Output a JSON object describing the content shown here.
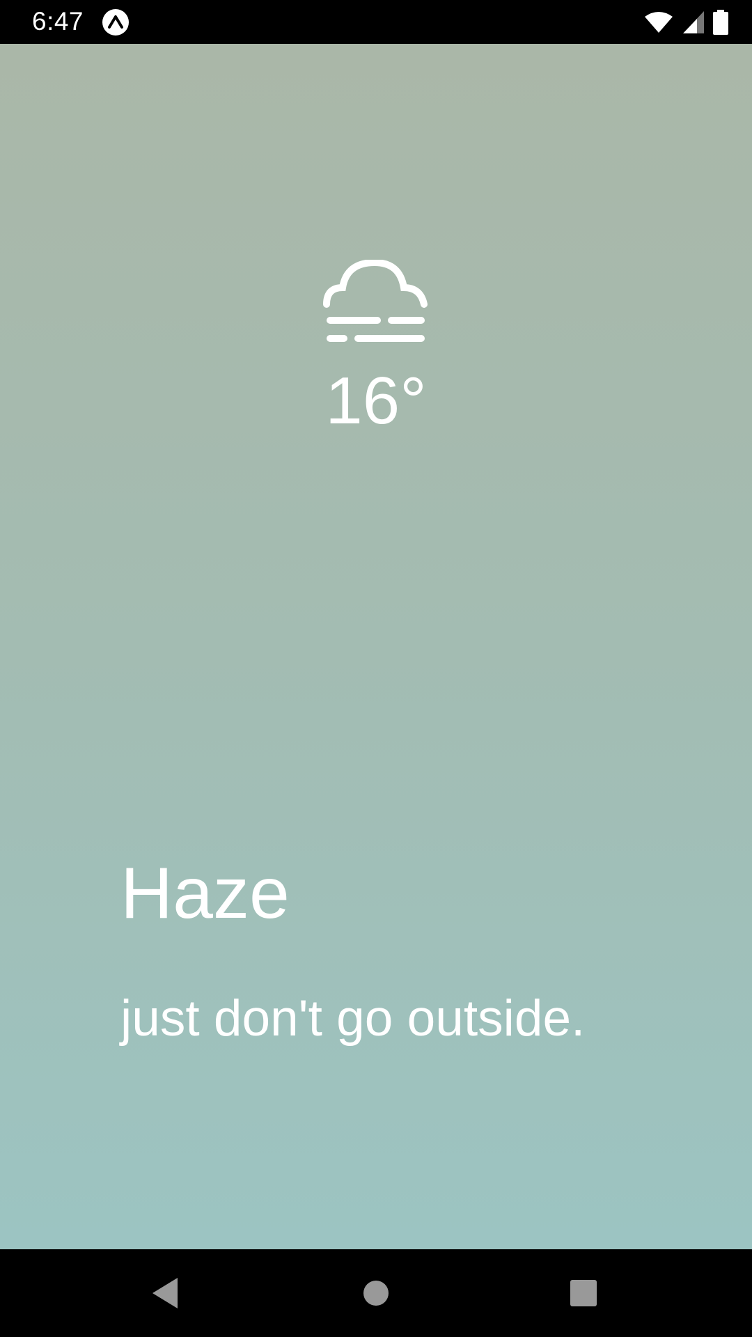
{
  "status_bar": {
    "time": "6:47",
    "app_icon": "expo-icon",
    "icons": [
      "wifi-icon",
      "cellular-signal-icon",
      "battery-icon"
    ]
  },
  "weather": {
    "icon": "haze-cloud-icon",
    "temperature": "16°",
    "condition": "Haze",
    "tagline": "just don't go outside."
  },
  "nav_bar": {
    "buttons": [
      "back-icon",
      "home-icon",
      "recents-icon"
    ]
  },
  "colors": {
    "gradient_top": "#aab7a8",
    "gradient_bottom": "#9cc4c2",
    "text": "#ffffff",
    "bars": "#000000"
  }
}
